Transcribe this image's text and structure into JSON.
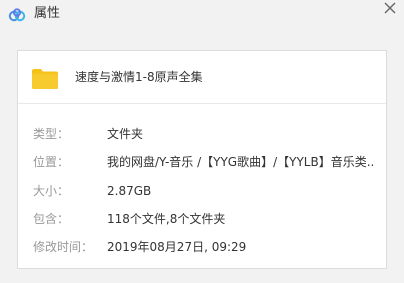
{
  "window": {
    "title": "属性",
    "app_icon": "cloud-icon",
    "close_icon": "close-icon",
    "accent_color": "#4a90e2"
  },
  "item": {
    "icon": "folder-icon",
    "icon_color": "#f5c21b",
    "name": "速度与激情1-8原声全集"
  },
  "properties": [
    {
      "label": "类型：",
      "value": "文件夹"
    },
    {
      "label": "位置：",
      "value": "我的网盘/Y-音乐 /【YYG歌曲】/【YYLB】音乐类..."
    },
    {
      "label": "大小：",
      "value": "2.87GB"
    },
    {
      "label": "包含：",
      "value": "118个文件,8个文件夹"
    },
    {
      "label": "修改时间：",
      "value": "2019年08月27日, 09:29"
    }
  ]
}
